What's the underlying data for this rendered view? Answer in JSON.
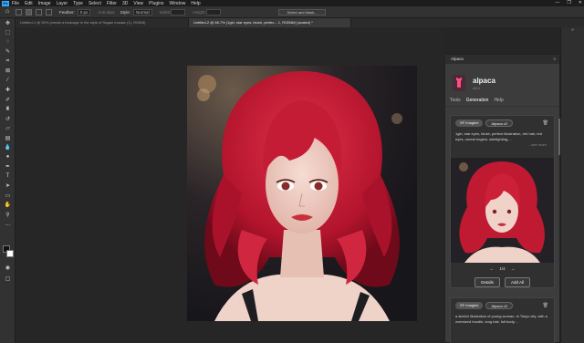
{
  "menu": [
    "File",
    "Edit",
    "Image",
    "Layer",
    "Type",
    "Select",
    "Filter",
    "3D",
    "View",
    "Plugins",
    "Window",
    "Help"
  ],
  "window_controls": [
    "—",
    "❐",
    "✕"
  ],
  "options": {
    "feather_label": "Feather:",
    "feather_value": "0 px",
    "antialias": "Anti-alias",
    "style_label": "Style:",
    "style_value": "Normal",
    "width_label": "Width:",
    "height_label": "Height:",
    "select_mask": "Select and Mask..."
  },
  "tabs": [
    {
      "label": "Untitled-1 @ 50% (create a bedcage in the style of Sagan mosaic (1), RGB/8)",
      "active": false
    },
    {
      "label": "Untitled-2 @ 66.7% (1girl, star eyes, blush, perfec... 1, RGB/8#) (scaled) *",
      "active": true
    }
  ],
  "panel": {
    "title": "Alpaca",
    "brand_name": "alpaca",
    "brand_sub": "v2.0",
    "tabs": [
      "Tools",
      "Generation",
      "Help"
    ],
    "active_tab": "Generation",
    "card1": {
      "chips": [
        "SF Imagine",
        "Alpaca v2"
      ],
      "prompt": "1girl, star eyes, blush, perfect illustration, red hair, red eyes, unreal engine, sidelighting,...",
      "more": "...see more",
      "pager": "1/4",
      "buttons": [
        "Details",
        "Add All"
      ]
    },
    "card2": {
      "chips": [
        "SF Imagine",
        "Alpaca v2"
      ],
      "prompt": "a sketch illustration of young woman, in Tokyo city, with a oversized hoodie, long hair, full body,..."
    }
  },
  "colors": {
    "accent": "#31a8ff",
    "hair": "#c8203a",
    "panel_bg": "#3c3c3c"
  },
  "icons": [
    "home-icon",
    "marquee-icon",
    "trash-icon",
    "chevron-left-icon",
    "chevron-right-icon"
  ]
}
